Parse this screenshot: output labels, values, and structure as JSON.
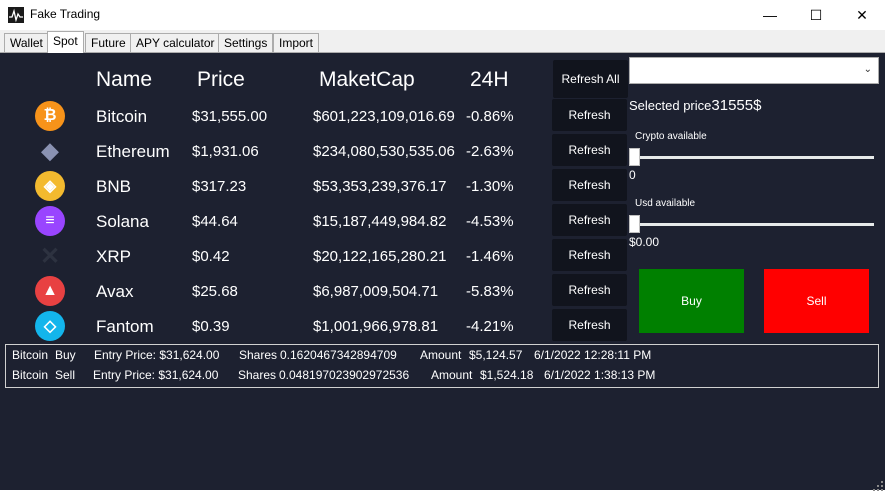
{
  "window": {
    "title": "Fake Trading",
    "minimize": "—",
    "maximize": "☐",
    "close": "✕"
  },
  "tabs": [
    {
      "label": "Wallet"
    },
    {
      "label": "Spot"
    },
    {
      "label": "Future"
    },
    {
      "label": "APY calculator"
    },
    {
      "label": "Settings"
    },
    {
      "label": "Import"
    }
  ],
  "active_tab": "Spot",
  "headers": {
    "name": "Name",
    "price": "Price",
    "marketcap": "MaketCap",
    "change": "24H"
  },
  "refresh_all_label": "Refresh All",
  "coins": [
    {
      "icon": "bitcoin-icon",
      "color": "#f7931a",
      "glyph": "₿",
      "name": "Bitcoin",
      "price": "$31,555.00",
      "marketcap": "$601,223,109,016.69",
      "change": "-0.86%",
      "refresh": "Refresh"
    },
    {
      "icon": "ethereum-icon",
      "color": "#627eea",
      "glyph": "◆",
      "name": "Ethereum",
      "price": "$1,931.06",
      "marketcap": "$234,080,530,535.06",
      "change": "-2.63%",
      "refresh": "Refresh"
    },
    {
      "icon": "bnb-icon",
      "color": "#f3ba2f",
      "glyph": "◈",
      "name": "BNB",
      "price": "$317.23",
      "marketcap": "$53,353,239,376.17",
      "change": "-1.30%",
      "refresh": "Refresh"
    },
    {
      "icon": "solana-icon",
      "color": "#9945ff",
      "glyph": "≡",
      "name": "Solana",
      "price": "$44.64",
      "marketcap": "$15,187,449,984.82",
      "change": "-4.53%",
      "refresh": "Refresh"
    },
    {
      "icon": "xrp-icon",
      "color": "#23292f",
      "glyph": "✕",
      "name": "XRP",
      "price": "$0.42",
      "marketcap": "$20,122,165,280.21",
      "change": "-1.46%",
      "refresh": "Refresh"
    },
    {
      "icon": "avax-icon",
      "color": "#e84142",
      "glyph": "▲",
      "name": "Avax",
      "price": "$25.68",
      "marketcap": "$6,987,009,504.71",
      "change": "-5.83%",
      "refresh": "Refresh"
    },
    {
      "icon": "fantom-icon",
      "color": "#13b5ec",
      "glyph": "◇",
      "name": "Fantom",
      "price": "$0.39",
      "marketcap": "$1,001,966,978.81",
      "change": "-4.21%",
      "refresh": "Refresh"
    }
  ],
  "trade": {
    "combo_value": "",
    "selected_price_label": "Selected price",
    "selected_price_value": "31555$",
    "crypto_label": "Crypto available",
    "crypto_value": "0",
    "crypto_slider_level": 0,
    "usd_label": "Usd available",
    "usd_value": "$0.00",
    "usd_slider_level": 0,
    "buy_label": "Buy",
    "sell_label": "Sell",
    "buy_color": "#008000",
    "sell_color": "#ff0000"
  },
  "orders": [
    {
      "coin": "Bitcoin",
      "side": "Buy",
      "entry": "Entry Price: $31,624.00",
      "shares_label": "Shares",
      "shares": "0.1620467342894709",
      "amount_label": "Amount",
      "amount": "$5,124.57",
      "time": "6/1/2022 12:28:11 PM"
    },
    {
      "coin": "Bitcoin",
      "side": "Sell",
      "entry": "Entry Price: $31,624.00",
      "shares_label": "Shares",
      "shares": "0.048197023902972536",
      "amount_label": "Amount",
      "amount": "$1,524.18",
      "time": "6/1/2022 1:38:13 PM"
    }
  ]
}
